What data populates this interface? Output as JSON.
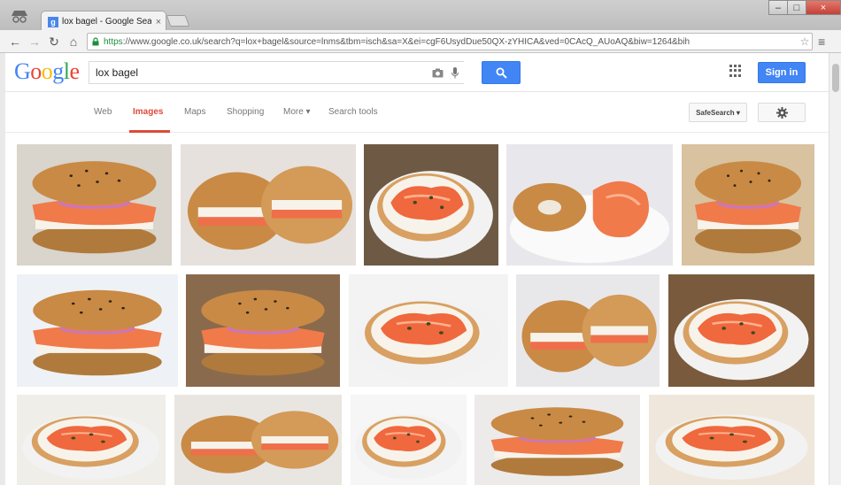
{
  "browser": {
    "tab_title": "lox bagel - Google Search",
    "tab_close": "×",
    "url_secure": "https",
    "url_rest": "://www.google.co.uk/search?q=lox+bagel&source=lnms&tbm=isch&sa=X&ei=cgF6UsydDue50QX-zYHICA&ved=0CAcQ_AUoAQ&biw=1264&bih",
    "window_buttons": [
      "–",
      "□",
      "×"
    ]
  },
  "google": {
    "logo_letters": [
      "G",
      "o",
      "o",
      "g",
      "l",
      "e"
    ],
    "logo_colors": [
      "#4285f4",
      "#ea4335",
      "#fbbc05",
      "#4285f4",
      "#34a853",
      "#ea4335"
    ],
    "search_value": "lox bagel",
    "signin_label": "Sign in"
  },
  "tabs": [
    {
      "label": "Web",
      "active": false
    },
    {
      "label": "Images",
      "active": true
    },
    {
      "label": "Maps",
      "active": false
    },
    {
      "label": "Shopping",
      "active": false
    },
    {
      "label": "More ▾",
      "active": false
    },
    {
      "label": "Search tools",
      "active": false
    }
  ],
  "safesearch_label": "SafeSearch ▾",
  "colors": {
    "accent_red": "#dd4b39",
    "button_blue": "#4285f4"
  },
  "images": [
    {
      "name": "poppy-seed-bagel-lox-onion",
      "kind": "bagel-side"
    },
    {
      "name": "halved-bagel-cream-cheese-lox",
      "kind": "bagel-halves"
    },
    {
      "name": "open-face-lox-capers-plate",
      "kind": "open-plate"
    },
    {
      "name": "bagel-and-smoked-salmon-plate",
      "kind": "bagel-and-fish"
    },
    {
      "name": "sesame-bagel-lox-plate",
      "kind": "bagel-side"
    },
    {
      "name": "toasted-bagel-lox-sandwich",
      "kind": "bagel-side"
    },
    {
      "name": "sesame-bagel-lox-onion-sandwich",
      "kind": "bagel-side"
    },
    {
      "name": "open-face-lox-onion-bagel",
      "kind": "open-plate"
    },
    {
      "name": "halved-everything-bagel-lox",
      "kind": "bagel-halves"
    },
    {
      "name": "lox-ribbons-on-bagel",
      "kind": "open-plate"
    },
    {
      "name": "lox-capers-onion-spread",
      "kind": "open-plate"
    },
    {
      "name": "lox-on-bagel-halves-board",
      "kind": "bagel-halves"
    },
    {
      "name": "lox-chives-bagel-half",
      "kind": "open-plate"
    },
    {
      "name": "sesame-bagel-lox-onion-rings",
      "kind": "bagel-side"
    },
    {
      "name": "lox-cream-cheese-bagel-lemon",
      "kind": "open-plate"
    }
  ]
}
